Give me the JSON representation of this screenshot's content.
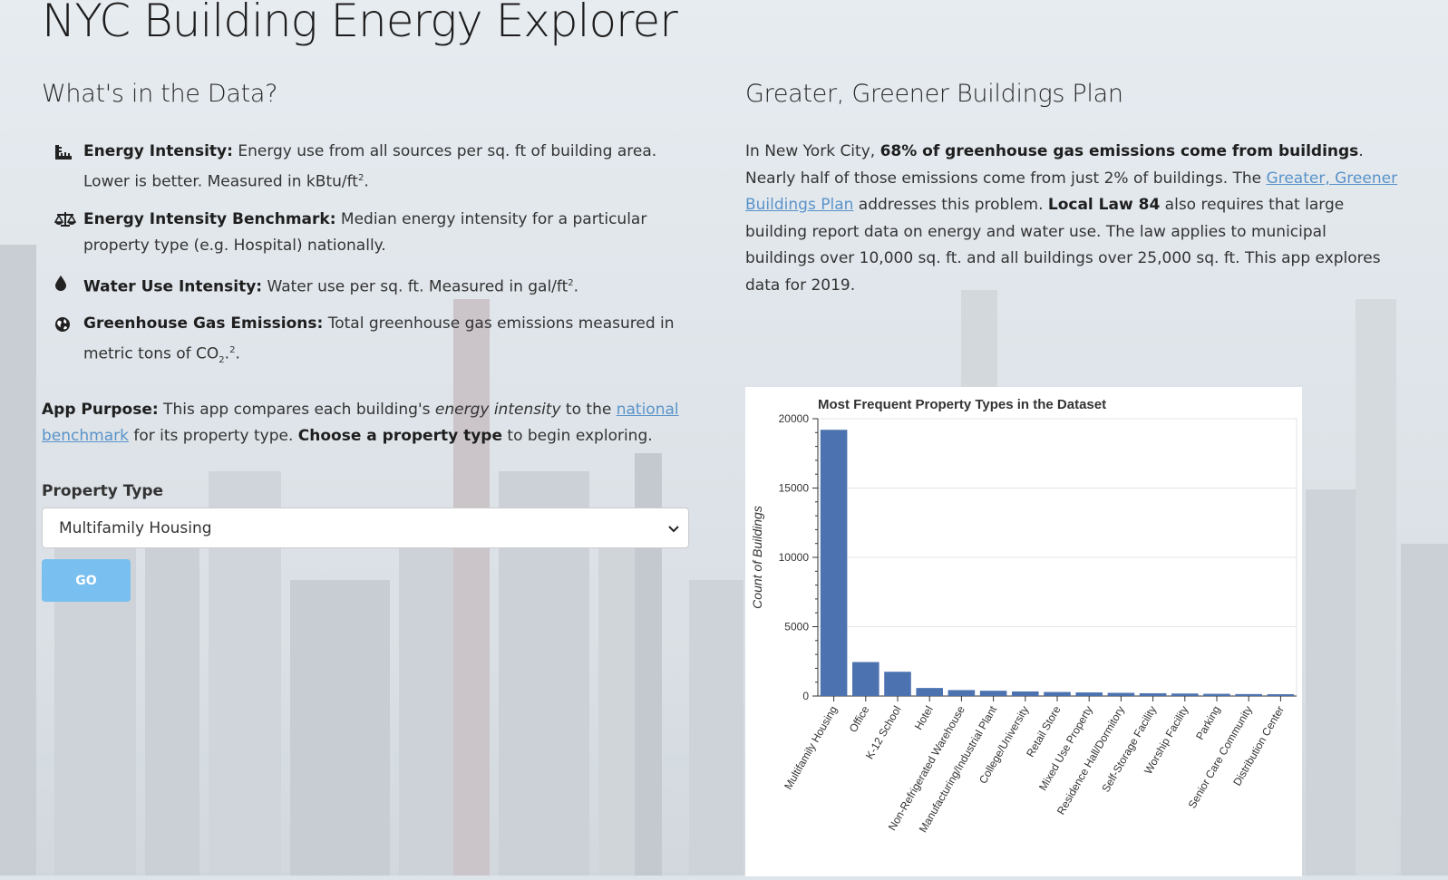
{
  "app": {
    "title": "NYC Building Energy Explorer"
  },
  "data_section": {
    "heading": "What's in the Data?",
    "items": [
      {
        "icon": "ruler-icon",
        "term": "Energy Intensity:",
        "text": " Energy use from all sources per sq. ft of building area. Lower is better. Measured in kBtu/ft",
        "sup": "2",
        "tail": "."
      },
      {
        "icon": "balance-scale-icon",
        "term": "Energy Intensity Benchmark:",
        "text": " Median energy intensity for a particular property type (e.g. Hospital) nationally.",
        "sup": "",
        "tail": ""
      },
      {
        "icon": "water-drop-icon",
        "term": "Water Use Intensity:",
        "text": " Water use per sq. ft. Measured in gal/ft",
        "sup": "2",
        "tail": "."
      },
      {
        "icon": "globe-icon",
        "term": "Greenhouse Gas Emissions:",
        "text": " Total greenhouse gas emissions measured in metric tons of CO",
        "sub": "2",
        "tail2": ".",
        "sup": "2",
        "tail": "."
      }
    ]
  },
  "purpose": {
    "label": "App Purpose:",
    "text1": " This app compares each building's ",
    "em": "energy intensity",
    "text2": " to the ",
    "link": "national benchmark",
    "text3": " for its property type. ",
    "bold": "Choose a property type",
    "text4": " to begin exploring."
  },
  "form": {
    "label": "Property Type",
    "selected": "Multifamily Housing",
    "button": "GO"
  },
  "plan": {
    "heading": "Greater, Greener Buildings Plan",
    "t1": "In New York City, ",
    "b1": "68% of greenhouse gas emissions come from buildings",
    "t2": ". Nearly half of those emissions come from just 2% of buildings. The ",
    "link": "Greater, Greener Buildings Plan",
    "t3": " addresses this problem. ",
    "b2": "Local Law 84",
    "t4": " also requires that large building report data on energy and water use. The law applies to municipal buildings over 10,000 sq. ft. and all buildings over 25,000 sq. ft. This app explores data for 2019."
  },
  "colors": {
    "bar": "#4c72b0",
    "accent": "#79bfef",
    "link": "#5a93c9"
  },
  "chart_data": {
    "type": "bar",
    "title": "Most Frequent Property Types in the Dataset",
    "xlabel": "",
    "ylabel": "Count of Buildings",
    "ylim": [
      0,
      20000
    ],
    "yticks": [
      0,
      5000,
      10000,
      15000,
      20000
    ],
    "grid": "horizontal",
    "categories": [
      "Multifamily Housing",
      "Office",
      "K-12 School",
      "Hotel",
      "Non-Refrigerated Warehouse",
      "Manufacturing/Industrial Plant",
      "College/University",
      "Retail Store",
      "Mixed Use Property",
      "Residence Hall/Dormitory",
      "Self-Storage Facility",
      "Worship Facility",
      "Parking",
      "Senior Care Community",
      "Distribution Center"
    ],
    "values": [
      19200,
      2450,
      1750,
      580,
      430,
      380,
      330,
      290,
      260,
      230,
      200,
      180,
      160,
      140,
      130
    ]
  }
}
